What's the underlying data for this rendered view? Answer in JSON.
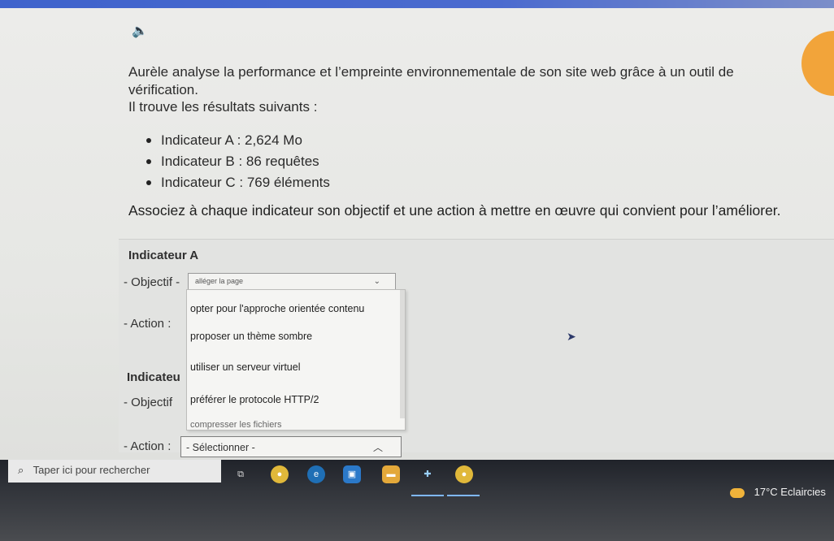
{
  "content": {
    "speaker_icon": "speaker-icon",
    "intro": "Aurèle analyse la performance et l’empreinte environnementale de son site web grâce à un outil de vérification.",
    "found": "Il trouve les résultats suivants :",
    "results": [
      "Indicateur A : 2,624 Mo",
      "Indicateur B : 86 requêtes",
      "Indicateur C : 769 éléments"
    ],
    "question": "Associez à chaque indicateur son objectif et une action à mettre en œuvre qui convient pour l’améliorer."
  },
  "form": {
    "indicator_a_title": "Indicateur A",
    "objectif_label": "- Objectif -",
    "objectif_value_partial": "alléger la page",
    "action_label": "- Action :",
    "indicator_b_title_partial": "Indicateu",
    "objectif_label_b": "- Objectif",
    "action_label_b": "- Action :",
    "action_b_value": "- Sélectionner -"
  },
  "dropdown": {
    "options": [
      "opter pour l'approche orientée contenu",
      "proposer un thème sombre",
      "utiliser un serveur virtuel",
      "préférer le protocole HTTP/2",
      "compresser les fichiers"
    ]
  },
  "taskbar": {
    "search_placeholder": "Taper ici pour rechercher",
    "weather": "17°C  Eclaircies",
    "colors": {
      "accent": "#4b6bcf",
      "taskbar": "#2a2d33",
      "weather_icon": "#f0b33a"
    }
  }
}
